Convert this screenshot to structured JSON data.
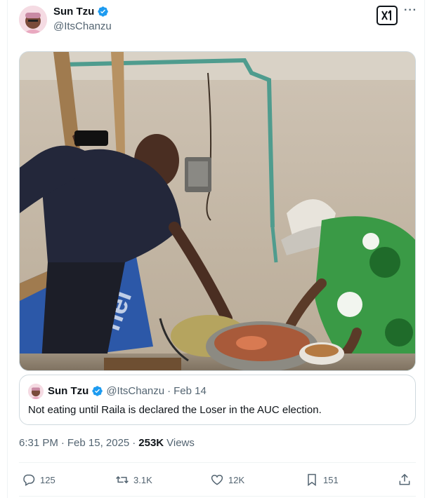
{
  "author": {
    "name": "Sun Tzu",
    "handle": "@ItsChanzu",
    "verified": true
  },
  "header": {
    "grok_icon": "grok-icon",
    "more_icon": "more-icon",
    "more_label": "···"
  },
  "media": {
    "kind": "photo",
    "description_icon": "photo-image"
  },
  "quote": {
    "name": "Sun Tzu",
    "handle": "@ItsChanzu",
    "separator": "·",
    "date": "Feb 14",
    "text": "Not eating until Raila is declared the Loser in the AUC election."
  },
  "timeline": {
    "time": "6:31 PM",
    "separator": "·",
    "date": "Feb 15, 2025",
    "separator2": "·",
    "views_count": "253K",
    "views_label": "Views"
  },
  "actions": {
    "reply_count": "125",
    "retweet_count": "3.1K",
    "like_count": "12K",
    "bookmark_count": "151"
  },
  "colors": {
    "verified": "#1d9bf0",
    "secondary_text": "#536471",
    "border": "#cfd9de"
  }
}
